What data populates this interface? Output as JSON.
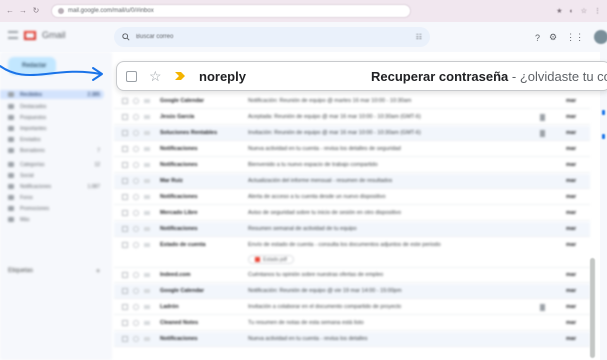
{
  "browser": {
    "url": "mail.google.com/mail/u/0/#inbox",
    "nav": [
      "←",
      "→",
      "↻",
      "⌂"
    ],
    "right_icons": [
      "★",
      "◐",
      "☆",
      "⋮"
    ]
  },
  "gmail": {
    "brand": "Gmail",
    "search_placeholder": "Buscar correo",
    "tune_glyph": "☷",
    "top_icons": [
      "?",
      "⚙",
      "⋮⋮"
    ]
  },
  "sidebar": {
    "compose": "Redactar",
    "items": [
      {
        "label": "Recibidos",
        "count": "2.385",
        "active": true
      },
      {
        "label": "Destacados",
        "count": ""
      },
      {
        "label": "Pospuestos",
        "count": ""
      },
      {
        "label": "Importantes",
        "count": ""
      },
      {
        "label": "Enviados",
        "count": ""
      },
      {
        "label": "Borradores",
        "count": "7"
      },
      {
        "label": "Categorías",
        "count": "12"
      },
      {
        "label": "Social",
        "count": ""
      },
      {
        "label": "Notificaciones",
        "count": "1.087"
      },
      {
        "label": "Foros",
        "count": ""
      },
      {
        "label": "Promociones",
        "count": ""
      },
      {
        "label": "Más",
        "count": ""
      }
    ],
    "labels_title": "Etiquetas",
    "labels_plus": "+"
  },
  "email_rows": [
    {
      "sender": "Google Calendar",
      "subject": "Notificación: Reunión de equipo @ martes 16 mar 10:00 - 10:30am",
      "date": "mar",
      "has_attachment": false
    },
    {
      "sender": "Jesús García",
      "subject": "Aceptada: Reunión de equipo @ mar 16 mar 10:00 - 10:30am (GMT-6)",
      "date": "mar",
      "has_attachment": true
    },
    {
      "sender": "Soluciones Rentables",
      "subject": "Invitación: Reunión de equipo @ mar 16 mar 10:00 - 10:30am (GMT-6)",
      "date": "mar",
      "has_attachment": true
    },
    {
      "sender": "Notificaciones",
      "subject": "Nueva actividad en tu cuenta - revisa los detalles de seguridad",
      "date": "mar",
      "has_attachment": false
    },
    {
      "sender": "Notificaciones",
      "subject": "Bienvenido a tu nuevo espacio de trabajo compartido",
      "date": "mar",
      "has_attachment": false
    },
    {
      "sender": "Mar Ruiz",
      "subject": "Actualización del informe mensual - resumen de resultados",
      "date": "mar",
      "has_attachment": false
    },
    {
      "sender": "Notificaciones",
      "subject": "Alerta de acceso a tu cuenta desde un nuevo dispositivo",
      "date": "mar",
      "has_attachment": false
    },
    {
      "sender": "Mercado Libre",
      "subject": "Aviso de seguridad sobre tu inicio de sesión en otro dispositivo",
      "date": "mar",
      "has_attachment": false
    },
    {
      "sender": "Notificaciones",
      "subject": "Resumen semanal de actividad de tu equipo",
      "date": "mar",
      "has_attachment": false
    },
    {
      "sender": "Estado de cuenta",
      "subject": "Envío de estado de cuenta - consulta los documentos adjuntos de este periodo",
      "date": "mar",
      "has_attachment": false,
      "chip": "Estado.pdf",
      "tall": true
    },
    {
      "sender": "Indeed.com",
      "subject": "Cuéntanos tu opinión sobre nuestras ofertas de empleo",
      "date": "mar",
      "has_attachment": false
    },
    {
      "sender": "Google Calendar",
      "subject": "Notificación: Reunión de equipo @ vie 19 mar 14:00 - 15:00pm",
      "date": "mar",
      "has_attachment": false
    },
    {
      "sender": "Ladrón",
      "subject": "Invitación a colaborar en el documento compartido de proyecto",
      "date": "mar",
      "has_attachment": true
    },
    {
      "sender": "Cleaned Notes",
      "subject": "Tu resumen de notas de esta semana está listo",
      "date": "mar",
      "has_attachment": false
    },
    {
      "sender": "Notificaciones",
      "subject": "Nueva actividad en tu cuenta - revisa los detalles",
      "date": "mar",
      "has_attachment": false
    }
  ],
  "highlight": {
    "sender": "noreply",
    "subject": "Recuperar contraseña",
    "separator": " - ",
    "snippet": "¿olvidaste tu contraseña?"
  },
  "colors": {
    "accent": "#1a73e8",
    "importance": "#f4b400",
    "browser_bar": "#f1e7ef"
  }
}
